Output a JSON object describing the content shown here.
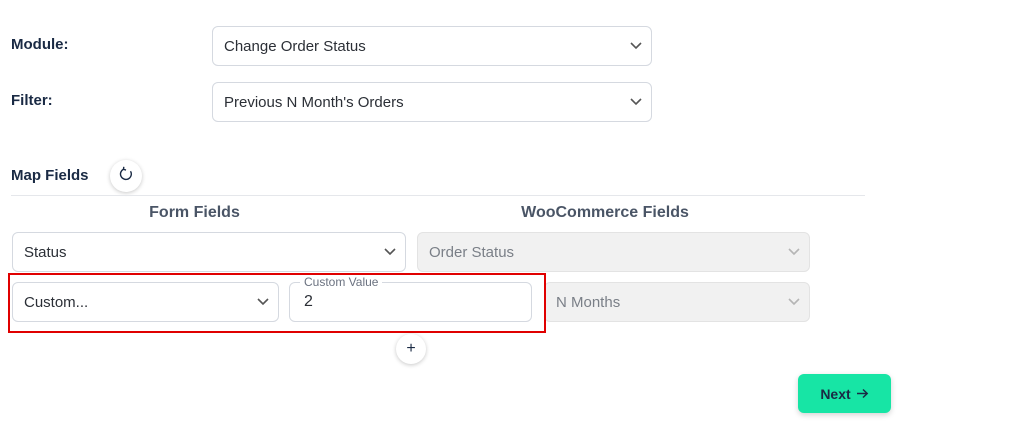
{
  "form": {
    "module_label": "Module:",
    "module_value": "Change Order Status",
    "filter_label": "Filter:",
    "filter_value": "Previous N Month's Orders"
  },
  "map_fields": {
    "title": "Map Fields",
    "form_fields_header": "Form Fields",
    "woo_fields_header": "WooCommerce Fields",
    "rows": [
      {
        "form_field": "Status",
        "woo_field": "Order Status"
      },
      {
        "form_field": "Custom...",
        "custom_value_legend": "Custom Value",
        "custom_value": "2",
        "woo_field": "N Months"
      }
    ],
    "add_label": "+"
  },
  "next_label": "Next",
  "colors": {
    "accent": "#17e5a5",
    "highlight": "#e00000"
  },
  "icons": {
    "refresh": "refresh-icon",
    "chevron": "chevron-down-icon",
    "arrow": "arrow-right-icon"
  }
}
